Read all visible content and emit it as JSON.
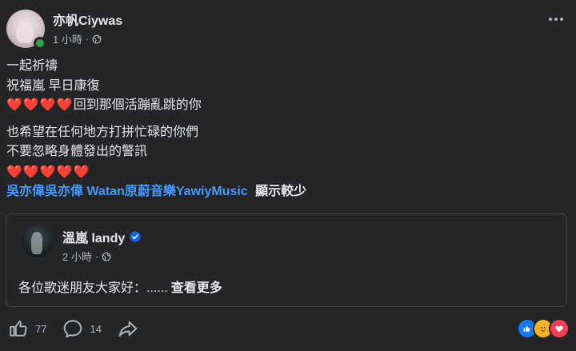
{
  "post": {
    "author": "亦帆Ciywas",
    "time": "1 小時",
    "separator": "·",
    "lines": [
      "一起祈禱",
      "祝福嵐 早日康復"
    ],
    "line3_hearts": "❤️❤️❤️❤️",
    "line3_text": "回到那個活蹦亂跳的你",
    "lines2": [
      "也希望在任何地方打拼忙碌的你們",
      "不要忽略身體發出的警訊"
    ],
    "line6_hearts": "❤️❤️❤️❤️❤️",
    "tags": [
      "吳亦偉吳亦偉",
      "Watan原蔚音樂YawiyMusic"
    ],
    "see_less": "顯示較少"
  },
  "shared": {
    "author": "溫嵐 landy",
    "time": "2 小時",
    "separator": "·",
    "text": "各位歌迷朋友大家好：......",
    "see_more": "查看更多"
  },
  "footer": {
    "like_count": "77",
    "comment_count": "14"
  },
  "icons": {
    "globe": "globe-icon",
    "more": "more-icon",
    "verified": "verified-badge-icon",
    "like": "thumbs-up-icon",
    "comment": "comment-icon",
    "share": "share-icon"
  },
  "colors": {
    "background": "#242526",
    "text": "#e4e6eb",
    "muted": "#b0b3b8",
    "link": "#4599ff",
    "online": "#31a24c",
    "heart": "#f02849"
  }
}
